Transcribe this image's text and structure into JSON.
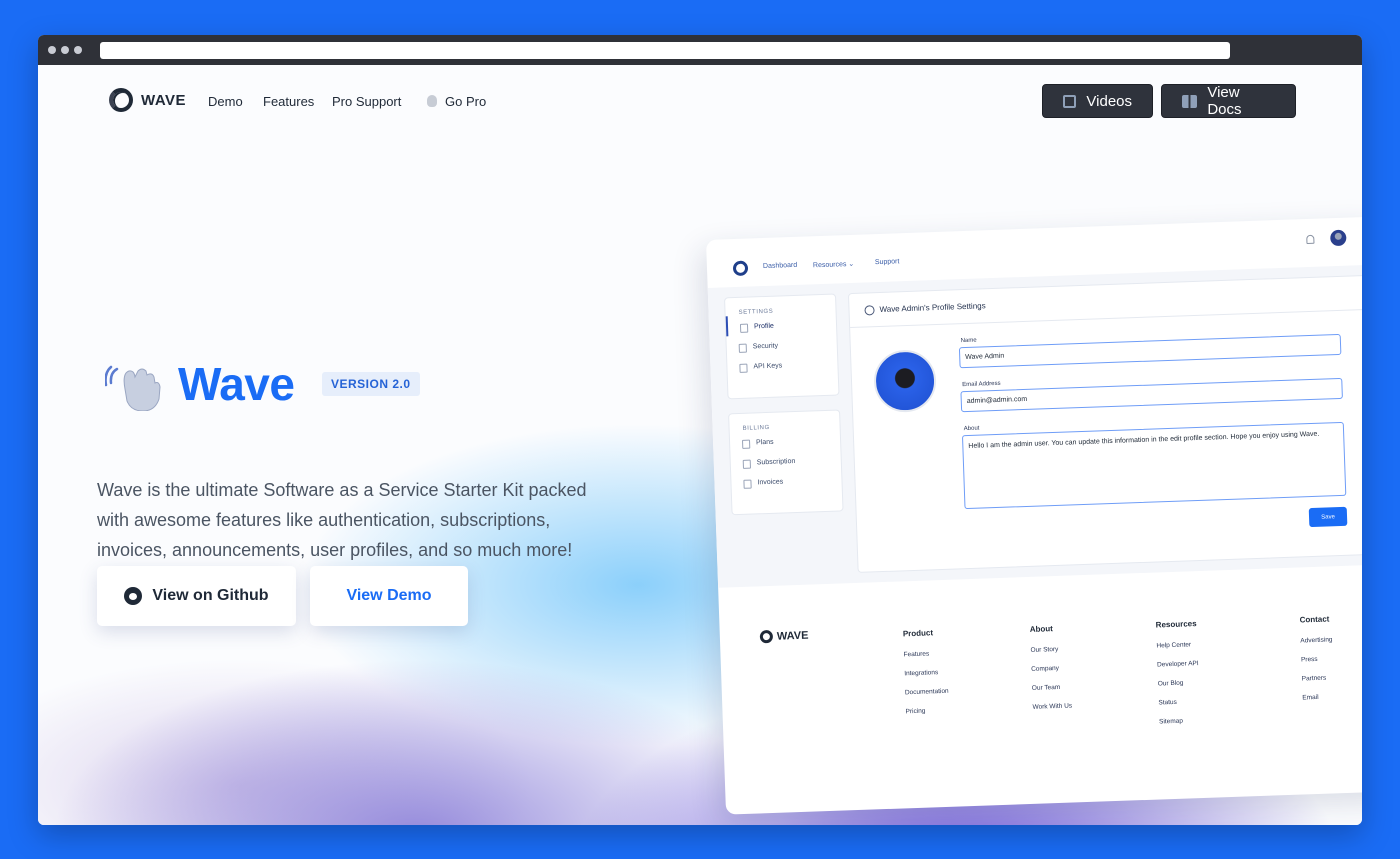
{
  "nav": {
    "brand": "WAVE",
    "links": [
      "Demo",
      "Features",
      "Pro Support",
      "Go Pro"
    ],
    "videos_label": "Videos",
    "docs_label": "View Docs"
  },
  "hero": {
    "title": "Wave",
    "version": "VERSION 2.0",
    "description": "Wave is the ultimate Software as a Service Starter Kit packed with awesome features like authentication, subscriptions, invoices, announcements, user profiles, and so much more!",
    "github_label": "View on Github",
    "demo_label": "View Demo"
  },
  "preview": {
    "nav": [
      "Dashboard",
      "Resources ⌄",
      "Support"
    ],
    "settings_title": "SETTINGS",
    "settings_items": [
      "Profile",
      "Security",
      "API Keys"
    ],
    "billing_title": "BILLING",
    "billing_items": [
      "Plans",
      "Subscription",
      "Invoices"
    ],
    "panel_title": "Wave Admin's Profile Settings",
    "name_label": "Name",
    "name_value": "Wave Admin",
    "email_label": "Email Address",
    "email_value": "admin@admin.com",
    "about_label": "About",
    "about_value": "Hello I am the admin user. You can update this information in the edit profile section. Hope you enjoy using Wave.",
    "save_label": "Save",
    "footer_brand": "WAVE",
    "footer_cols": [
      {
        "title": "Product",
        "items": [
          "Features",
          "Integrations",
          "Documentation",
          "Pricing"
        ]
      },
      {
        "title": "About",
        "items": [
          "Our Story",
          "Company",
          "Our Team",
          "Work With Us"
        ]
      },
      {
        "title": "Resources",
        "items": [
          "Help Center",
          "Developer API",
          "Our Blog",
          "Status",
          "Sitemap"
        ]
      },
      {
        "title": "Contact",
        "items": [
          "Advertising",
          "Press",
          "Partners",
          "Email"
        ]
      }
    ]
  },
  "colors": {
    "frame_blue": "#1a6cf5",
    "brand_blue": "#1a6cf5",
    "dark_button": "#2f333c"
  }
}
